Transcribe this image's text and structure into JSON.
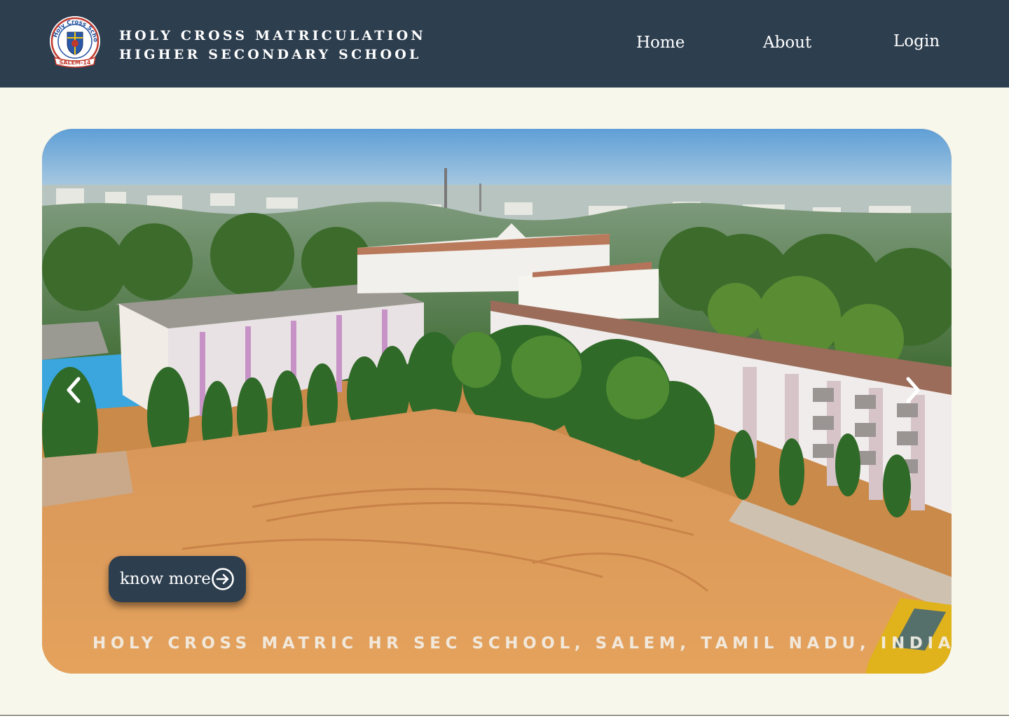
{
  "header": {
    "brand_line1": "HOLY CROSS MATRICULATION",
    "brand_line2": "HIGHER SECONDARY SCHOOL",
    "logo": {
      "icon": "school-crest-logo",
      "ring_text": "Holy Cross School",
      "ribbon_text": "SALEM-14"
    },
    "nav": {
      "home": "Home",
      "about": "About",
      "login": "Login"
    }
  },
  "hero": {
    "image": "aerial-campus-photo",
    "caption": "HOLY CROSS MATRIC HR SEC SCHOOL, SALEM, TAMIL NADU, INDIA",
    "know_more_label": "know more",
    "know_more_icon": "arrow-right-circle-icon",
    "prev_icon": "chevron-left-icon",
    "next_icon": "chevron-right-icon"
  },
  "colors": {
    "navbar": "#2d3e4f",
    "page_background": "#f7f7ec",
    "button": "#2d3e4f",
    "text_light": "#ffffff"
  }
}
